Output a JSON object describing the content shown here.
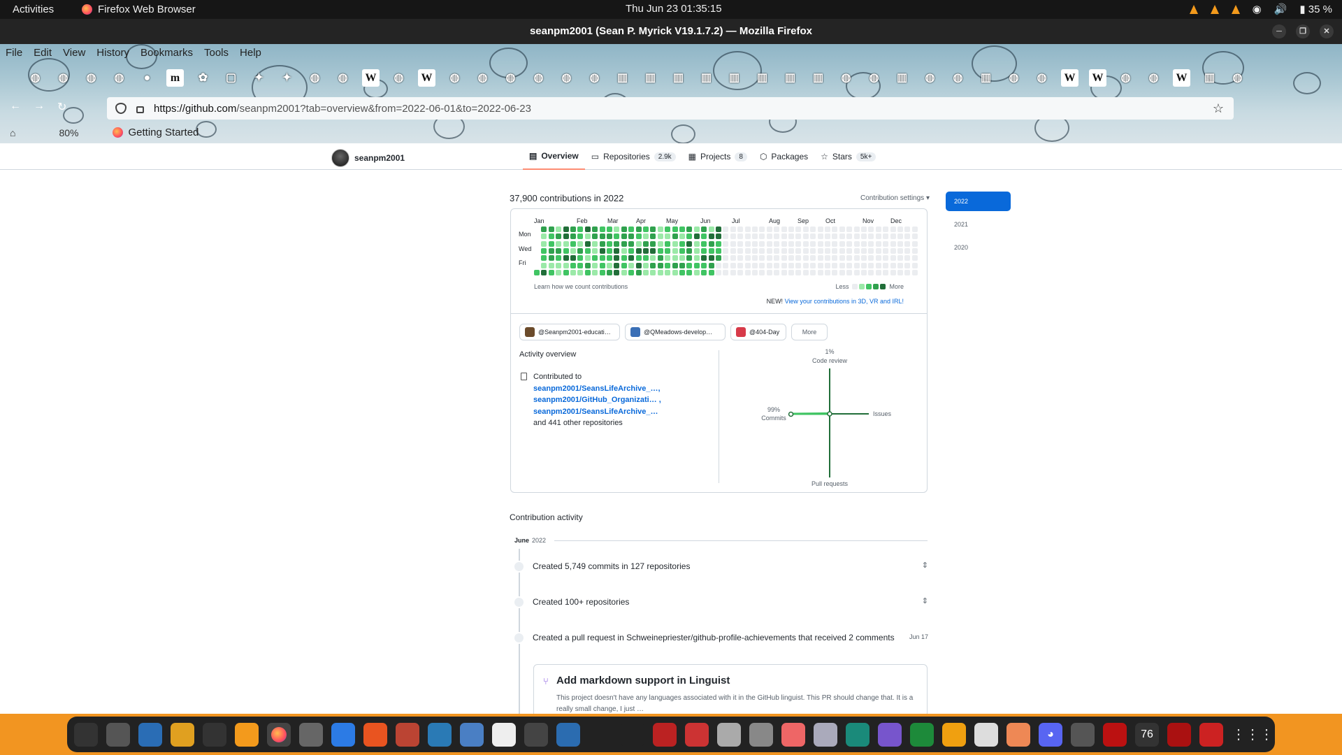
{
  "system": {
    "activities": "Activities",
    "app_name": "Firefox Web Browser",
    "clock": "Thu Jun 23  01:35:15",
    "battery": "35 %"
  },
  "window": {
    "title": "seanpm2001 (Sean P. Myrick V19.1.7.2) — Mozilla Firefox"
  },
  "menubar": [
    "File",
    "Edit",
    "View",
    "History",
    "Bookmarks",
    "Tools",
    "Help"
  ],
  "toolbar": {
    "url_host": "https://github.com",
    "url_path": "/seanpm2001?tab=overview&from=2022-06-01&to=2022-06-23",
    "zoom": "80%",
    "bookmark": "Getting Started",
    "bookmark_icons": [
      "github",
      "github",
      "github",
      "github",
      "firefox",
      "m",
      "gear",
      "blank",
      "bird",
      "bird",
      "github",
      "github",
      "wikipedia",
      "github",
      "wikipedia",
      "github",
      "github",
      "github",
      "github",
      "github",
      "github",
      "archive",
      "archive",
      "archive",
      "archive",
      "archive",
      "archive",
      "archive",
      "archive",
      "github",
      "github",
      "archive",
      "github",
      "github",
      "archive",
      "github",
      "github",
      "wikipedia",
      "wikipedia",
      "github",
      "github",
      "wikipedia",
      "archive",
      "github"
    ]
  },
  "profile": {
    "username": "seanpm2001",
    "tabs": [
      {
        "label": "Overview",
        "count": ""
      },
      {
        "label": "Repositories",
        "count": "2.9k"
      },
      {
        "label": "Projects",
        "count": "8"
      },
      {
        "label": "Packages",
        "count": ""
      },
      {
        "label": "Stars",
        "count": "5k+"
      }
    ]
  },
  "contributions": {
    "heading": "37,900 contributions in 2022",
    "settings": "Contribution settings ▾",
    "months": [
      "Jan",
      "Feb",
      "Mar",
      "Apr",
      "May",
      "Jun",
      "Jul",
      "Aug",
      "Sep",
      "Oct",
      "Nov",
      "Dec"
    ],
    "days": [
      "Mon",
      "Wed",
      "Fri"
    ],
    "learn": "Learn how we count contributions",
    "less": "Less",
    "more": "More",
    "new_prefix": "NEW!",
    "new_link": "View your contributions in 3D, VR and IRL!",
    "colors": [
      "#ebedf0",
      "#9be9a8",
      "#40c463",
      "#30a14e",
      "#216e39"
    ]
  },
  "orgs": [
    {
      "label": "@Seanpm2001-educati…",
      "color": "#6b4b2b"
    },
    {
      "label": "@QMeadows-develop…",
      "color": "#3a6fb6"
    },
    {
      "label": "@404-Day",
      "color": "#d73a49"
    }
  ],
  "orgs_more": "More",
  "activity_overview": {
    "title": "Activity overview",
    "contributed_to": "Contributed to",
    "repos": [
      "seanpm2001/SeansLifeArchive_…,",
      "seanpm2001/GitHub_Organizati… ,",
      "seanpm2001/SeansLifeArchive_…"
    ],
    "others": "and 441 other repositories",
    "radar": {
      "code_review_pct": "1%",
      "code_review": "Code review",
      "commits_pct": "99%",
      "commits": "Commits",
      "issues": "Issues",
      "pull_requests": "Pull requests",
      "values": {
        "code_review": 1,
        "commits": 99,
        "issues": 0,
        "pull_requests": 0
      }
    }
  },
  "years": [
    "2022",
    "2021",
    "2020"
  ],
  "activity": {
    "title": "Contribution activity",
    "month": "June",
    "year": "2022",
    "items": [
      {
        "text": "Created 5,749 commits in 127 repositories",
        "date": ""
      },
      {
        "text": "Created 100+ repositories",
        "date": ""
      },
      {
        "text": "Created a pull request in Schweinepriester/github-profile-achievements that received 2 comments",
        "date": "Jun 17"
      }
    ],
    "pr_title": "Add markdown support in Linguist",
    "pr_desc": "This project doesn't have any languages associated with it in the GitHub linguist. This PR should change that. It is a really small change, I just …"
  },
  "dock_icons": [
    "system-monitor",
    "files",
    "writer",
    "archive",
    "terminal",
    "vlc",
    "firefox",
    "settings",
    "help",
    "software",
    "monitor",
    "text-editor",
    "settings2",
    "document",
    "plane",
    "virtualbox",
    "obs",
    "inkscape",
    "ship",
    "mario",
    "tablet",
    "search",
    "color",
    "drive",
    "app",
    "camera",
    "calc",
    "impress",
    "doc",
    "present",
    "discord",
    "clock",
    "pdf",
    "76",
    "emulator",
    "first-aid"
  ]
}
